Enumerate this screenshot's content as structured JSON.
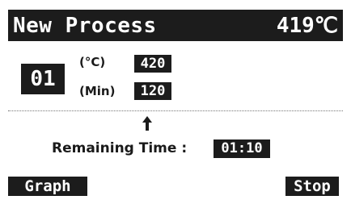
{
  "header": {
    "title": "New Process",
    "current_temp": "419℃"
  },
  "step": {
    "number": "01",
    "temp_unit_label": "(°C)",
    "temp_value": "420",
    "time_unit_label": "(Min)",
    "time_value": "120"
  },
  "remaining": {
    "label": "Remaining Time :",
    "value": "01:10"
  },
  "softkeys": {
    "left_label": "Graph",
    "right_label": "Stop"
  },
  "colors": {
    "inverse_bg": "#1c1c1c",
    "inverse_fg": "#ffffff",
    "background": "#ffffff"
  }
}
